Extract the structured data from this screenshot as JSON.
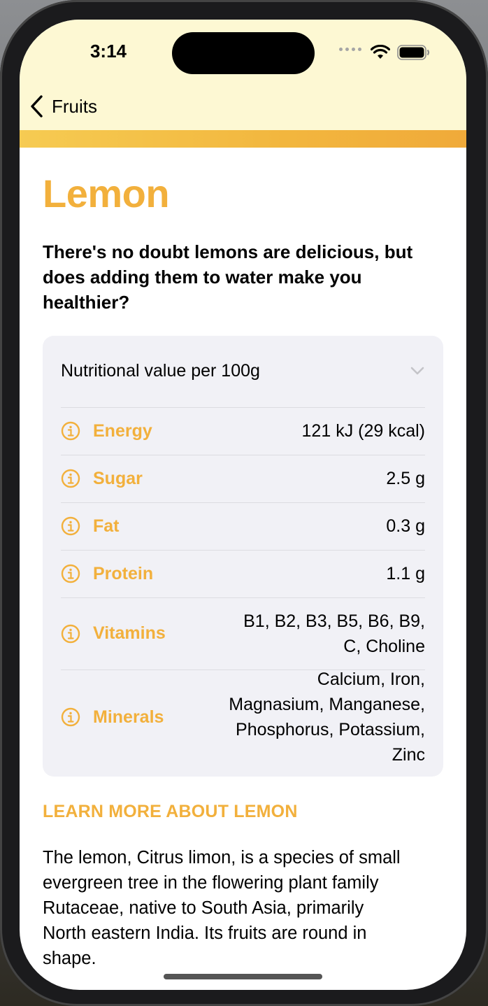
{
  "status_bar": {
    "time": "3:14"
  },
  "nav": {
    "back_label": "Fruits"
  },
  "colors": {
    "accent": "#f2b03c",
    "header_bg": "#fdf8d3",
    "card_bg": "#f1f1f6"
  },
  "fruit": {
    "title": "Lemon",
    "headline": "There's no doubt lemons are delicious, but does adding them to water make you healthier?",
    "nutrition": {
      "header": "Nutritional value per 100g",
      "rows": [
        {
          "label": "Energy",
          "value": "121 kJ (29 kcal)",
          "icon": "info-icon"
        },
        {
          "label": "Sugar",
          "value": "2.5 g",
          "icon": "info-icon"
        },
        {
          "label": "Fat",
          "value": "0.3 g",
          "icon": "info-icon"
        },
        {
          "label": "Protein",
          "value": "1.1 g",
          "icon": "info-icon"
        },
        {
          "label": "Vitamins",
          "value_lines": [
            "B1, B2, B3, B5, B6, B9,",
            "C, Choline"
          ],
          "icon": "info-icon"
        },
        {
          "label": "Minerals",
          "value_lines": [
            "Calcium, Iron,",
            "Magnasium, Manganese,",
            "Phosphorus, Potassium,",
            "Zinc"
          ],
          "icon": "info-icon"
        }
      ]
    },
    "learn_more_heading": "LEARN MORE ABOUT LEMON",
    "description_lines": [
      "The lemon, Citrus limon, is a species of small",
      "evergreen tree in the flowering plant family",
      "Rutaceae, native to South Asia, primarily",
      "North eastern India. Its fruits are round in",
      "shape."
    ]
  }
}
